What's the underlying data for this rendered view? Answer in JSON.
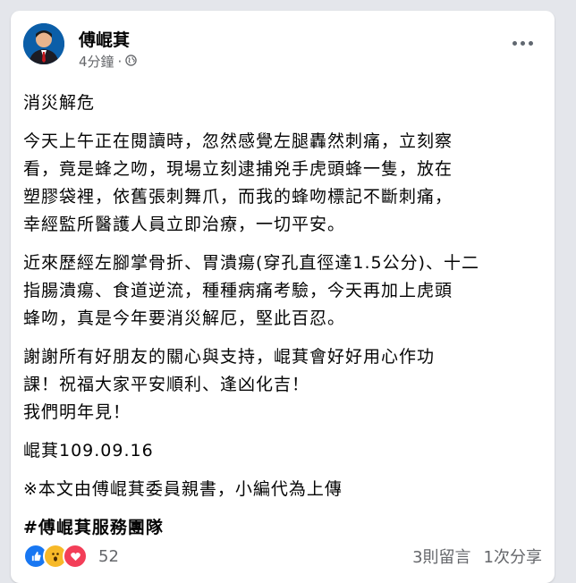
{
  "post": {
    "author": "傅崐萁",
    "time": "4分鐘",
    "separator": "·",
    "privacy_icon": "globe-icon",
    "paragraphs": [
      "消災解危",
      "今天上午正在閱讀時，忽然感覺左腿轟然刺痛，立刻察\n看，竟是蜂之吻，現場立刻逮捕兇手虎頭蜂一隻，放在\n塑膠袋裡，依舊張刺舞爪，而我的蜂吻標記不斷刺痛，\n幸經監所醫護人員立即治療，一切平安。",
      "近來歷經左腳掌骨折、胃潰瘍(穿孔直徑達1.5公分)、十二\n指腸潰瘍、食道逆流，種種病痛考驗，今天再加上虎頭\n蜂吻，真是今年要消災解厄，堅此百忍。",
      "謝謝所有好朋友的關心與支持，崐萁會好好用心作功\n課！祝福大家平安順利、逢凶化吉！\n我們明年見！",
      "崐萁109.09.16",
      "※本文由傅崐萁委員親書，小編代為上傳"
    ],
    "hashtag": "#傅崐萁服務團隊",
    "reaction_count": "52",
    "comments": "3則留言",
    "shares": "1次分享"
  },
  "colors": {
    "like": "#1877f2",
    "wow": "#f7b928",
    "love": "#f33e58"
  }
}
